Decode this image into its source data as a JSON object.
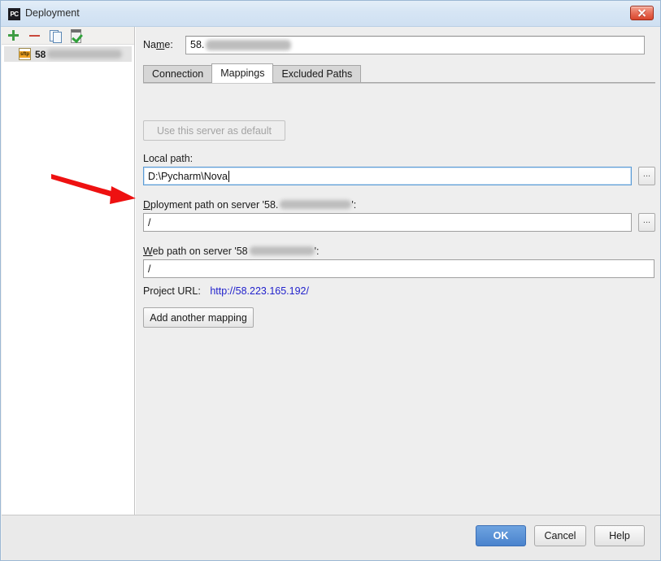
{
  "window": {
    "title": "Deployment",
    "app_icon": "PC",
    "app_icon_label": "pycharm-icon",
    "close_label": "close-icon"
  },
  "sidebar": {
    "toolbar": [
      {
        "name": "add-server-button",
        "icon": "plus-icon",
        "tooltip": "Add"
      },
      {
        "name": "remove-server-button",
        "icon": "minus-icon",
        "tooltip": "Remove"
      },
      {
        "name": "copy-server-button",
        "icon": "copy-icon",
        "tooltip": "Copy"
      },
      {
        "name": "test-connection-button",
        "icon": "check-list-icon",
        "tooltip": "Test connection"
      }
    ],
    "servers": [
      {
        "label": "58",
        "icon": "sftp-icon",
        "redacted": true,
        "selected": true
      }
    ]
  },
  "form": {
    "name_label": "Na",
    "name_label_mnemonic": "m",
    "name_label_suffix": "e:",
    "name_value": "58.",
    "name_placeholder": ""
  },
  "tabs": [
    {
      "label": "Connection",
      "selected": false
    },
    {
      "label": "Mappings",
      "selected": true
    },
    {
      "label": "Excluded Paths",
      "selected": false
    }
  ],
  "mappings": {
    "use_server_default_label": "Use this server as default",
    "use_server_default_enabled": false,
    "local_path": {
      "label_prefix": "L",
      "label_mnemonic": "",
      "label": "Local path:",
      "value": "D:\\Pycharm\\Nova",
      "focused": true,
      "browse_label": "...",
      "browse_name": "browse-local-path-button"
    },
    "deployment_path": {
      "label_before": "D",
      "label_mnemonic": "e",
      "label_after": "ployment path on server '58.",
      "label_end": "':",
      "value": "/",
      "focused": false,
      "browse_label": "...",
      "browse_name": "browse-deployment-path-button"
    },
    "web_path": {
      "label_before": "",
      "label_mnemonic": "W",
      "label_after": "eb path on server '58",
      "label_end": "':",
      "value": "/",
      "focused": false
    },
    "project_url_label": "Project URL:",
    "project_url": "http://58.223.165.192/",
    "add_another_mapping_label": "Add another mapping"
  },
  "footer": {
    "ok_label": "OK",
    "cancel_label": "Cancel",
    "help_label": "Help"
  },
  "annotation": {
    "type": "arrow",
    "color": "#ee1111",
    "points_at": "deployment-path-input"
  },
  "colors": {
    "titlebar": "#d6e5f4",
    "window_border": "#9cb8d4",
    "panel_bg": "#eeeeee",
    "sidebar_bg": "#ffffff",
    "accent_ok": "#4a83cd",
    "link": "#2222cc",
    "annotation": "#ee1111",
    "focus_border": "#5b9bd5"
  }
}
